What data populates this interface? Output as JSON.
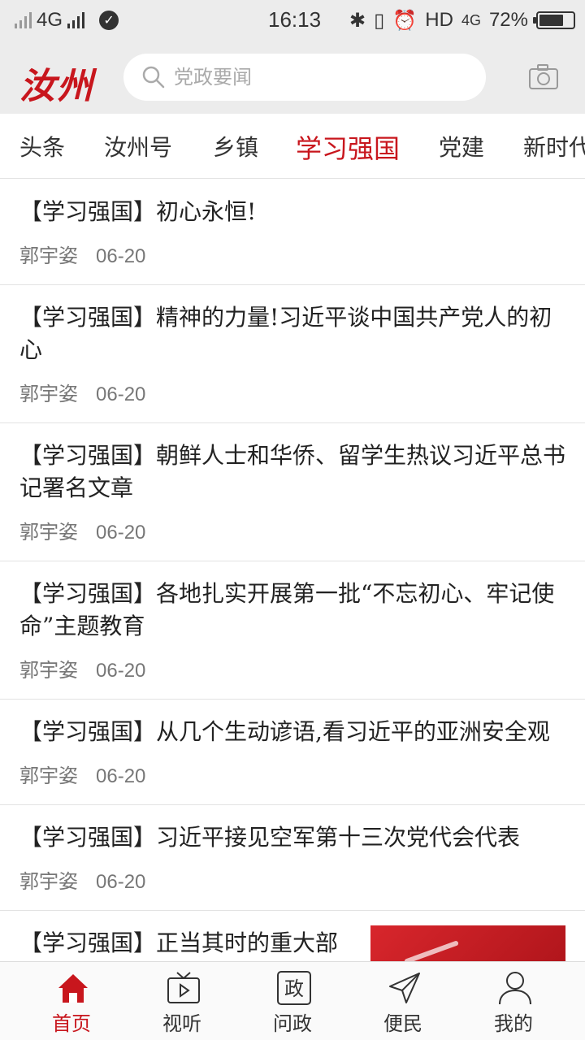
{
  "status_bar": {
    "network": "4G",
    "time": "16:13",
    "hd": "HD",
    "network2": "4G",
    "battery": "72%",
    "battery_level": 0.72
  },
  "header": {
    "logo": "汝州",
    "search_placeholder": "党政要闻"
  },
  "tabs": [
    {
      "label": "头条"
    },
    {
      "label": "汝州号"
    },
    {
      "label": "乡镇"
    },
    {
      "label": "学习强国",
      "active": true
    },
    {
      "label": "党建"
    },
    {
      "label": "新时代"
    }
  ],
  "articles": [
    {
      "title": "【学习强国】初心永恒!",
      "author": "郭宇姿",
      "date": "06-20"
    },
    {
      "title": "【学习强国】精神的力量!习近平谈中国共产党人的初心",
      "author": "郭宇姿",
      "date": "06-20"
    },
    {
      "title": "【学习强国】朝鲜人士和华侨、留学生热议习近平总书记署名文章",
      "author": "郭宇姿",
      "date": "06-20"
    },
    {
      "title": "【学习强国】各地扎实开展第一批“不忘初心、牢记使命”主题教育",
      "author": "郭宇姿",
      "date": "06-20"
    },
    {
      "title": "【学习强国】从几个生动谚语,看习近平的亚洲安全观",
      "author": "郭宇姿",
      "date": "06-20"
    },
    {
      "title": "【学习强国】习近平接见空军第十三次党代会代表",
      "author": "郭宇姿",
      "date": "06-20"
    },
    {
      "title": "【学习强国】正当其时的重大部",
      "author": "",
      "date": ""
    }
  ],
  "bottom_nav": [
    {
      "label": "首页",
      "icon": "home-icon",
      "active": true
    },
    {
      "label": "视听",
      "icon": "tv-icon"
    },
    {
      "label": "问政",
      "icon": "zheng-icon",
      "glyph": "政"
    },
    {
      "label": "便民",
      "icon": "send-icon"
    },
    {
      "label": "我的",
      "icon": "user-icon"
    }
  ],
  "colors": {
    "accent": "#c8161d",
    "header_bg": "#ececec"
  }
}
